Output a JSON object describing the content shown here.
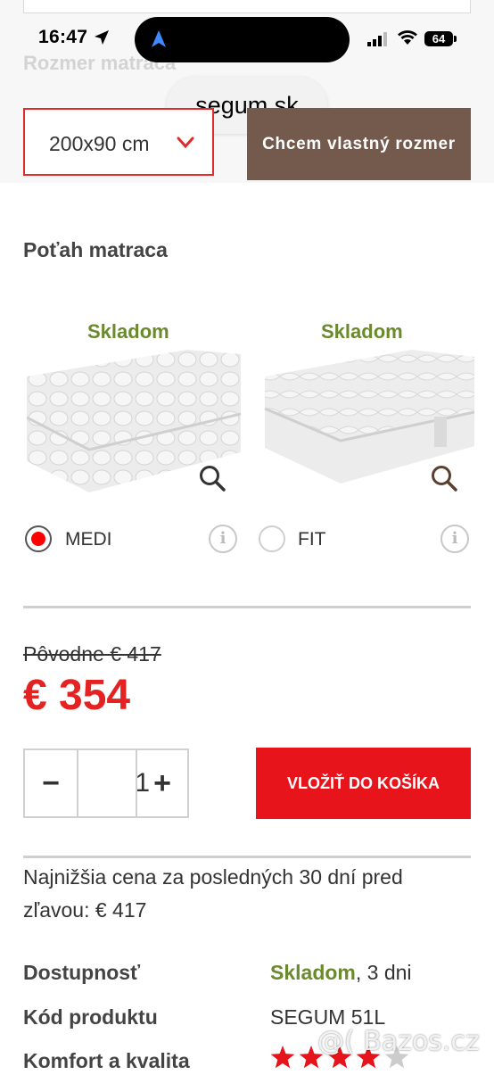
{
  "status_bar": {
    "time": "16:47",
    "battery": "64"
  },
  "browser": {
    "url": "segum.sk"
  },
  "size_section": {
    "label": "Rozmer matraca",
    "selected_size": "200x90 cm",
    "custom_button": "Chcem vlastný rozmer"
  },
  "cover_section": {
    "title": "Poťah matraca",
    "options": [
      {
        "availability": "Skladom",
        "label": "MEDI",
        "selected": true
      },
      {
        "availability": "Skladom",
        "label": "FIT",
        "selected": false
      }
    ]
  },
  "pricing": {
    "original": "Pôvodne € 417",
    "current": "€ 354",
    "quantity": "1",
    "minus": "−",
    "plus": "+",
    "add_to_cart": "VLOŽIŤ DO KOŠÍKA",
    "lowest_price_note": "Najnižšia cena za posledných 30 dní pred zľavou: € 417"
  },
  "details": {
    "availability_label": "Dostupnosť",
    "availability_value": "Skladom",
    "availability_days": ", 3 dni",
    "code_label": "Kód produktu",
    "code_value": "SEGUM 51L",
    "comfort_label": "Komfort a kvalita",
    "comfort_rating": 4,
    "comfort_max": 5
  },
  "watermark": "@( Bazos.cz",
  "colors": {
    "accent_red": "#e8141c",
    "price_red": "#e52222",
    "stock_green": "#6b8a2e",
    "brown_button": "#735a4c"
  },
  "icons": [
    "location-arrow-icon",
    "navigation-arrow-icon",
    "signal-icon",
    "wifi-icon",
    "battery-icon",
    "chevron-down-icon",
    "magnifier-icon",
    "info-icon",
    "star-icon"
  ]
}
